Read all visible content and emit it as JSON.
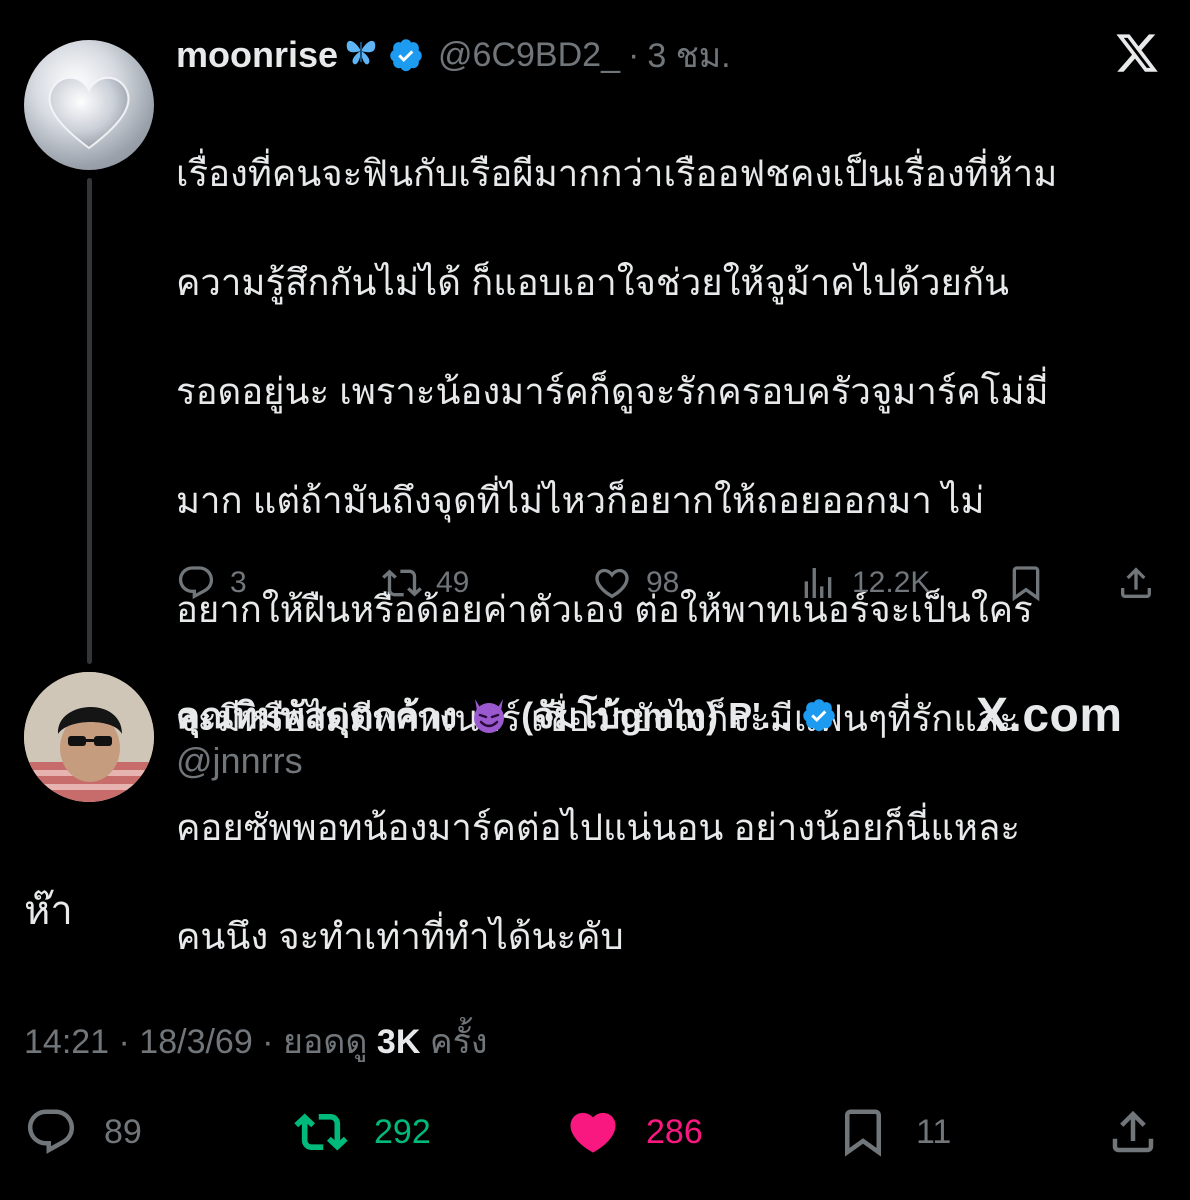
{
  "parent_tweet": {
    "display_name": "moonrise",
    "handle": "@6C9BD2_",
    "separator": "·",
    "time": "3 ชม.",
    "body_lines": [
      "เรื่องที่คนจะฟินกับเรือผีมากกว่าเรืออฟชคงเป็นเรื่องที่ห้าม",
      "ความรู้สึกกันไม่ได้ ก็แอบเอาใจช่วยให้จูม้าคไปด้วยกัน",
      "รอดอยู่นะ เพราะน้องมาร์คก็ดูจะรักครอบครัวจูมาร์คโม่มี่",
      "มาก แต่ถ้ามันถึงจุดที่ไม่ไหวก็อยากให้ถอยออกมา ไม่",
      "อยากให้ฝืนหรือด้อยค่าตัวเอง ต่อให้พาทเนอร์จะเป็นใคร",
      "จะมีหรือไม่มีพาทเนอร์ เชื่อว่ายังไงก็จะมีแฟนๆที่รักและ",
      "คอยซัพพอทน้องมาร์คต่อไปแน่นอน อย่างน้อยก็นี่แหละ",
      "คนนึง จะทำเท่าที่ทำได้นะคับ"
    ],
    "counts": {
      "replies": "3",
      "reposts": "49",
      "likes": "98",
      "views": "12.2K"
    }
  },
  "reply_tweet": {
    "display_name_part1": "คุณทิมพัสดุตกค้าง",
    "display_name_part2": "(จัมโบ้gmm) P'...",
    "handle": "@jnnrrs",
    "watermark": "X.com",
    "body": "ห๊า",
    "timestamp": "14:21 · 18/3/69 · ยอดดู ",
    "views": "3K",
    "views_suffix": " ครั้ง",
    "counts": {
      "replies": "89",
      "reposts": "292",
      "likes": "286",
      "bookmarks": "11"
    }
  },
  "colors": {
    "background": "#000000",
    "text": "#e7e9ea",
    "muted": "#71767b",
    "verified": "#1d9bf0",
    "repost_active": "#00ba7c",
    "like_active": "#f91880"
  },
  "icons": [
    "verified-badge-icon",
    "x-logo-icon",
    "reply-icon",
    "repost-icon",
    "like-icon",
    "views-icon",
    "bookmark-icon",
    "share-icon",
    "butterfly-emoji",
    "smiling-devil-emoji"
  ]
}
